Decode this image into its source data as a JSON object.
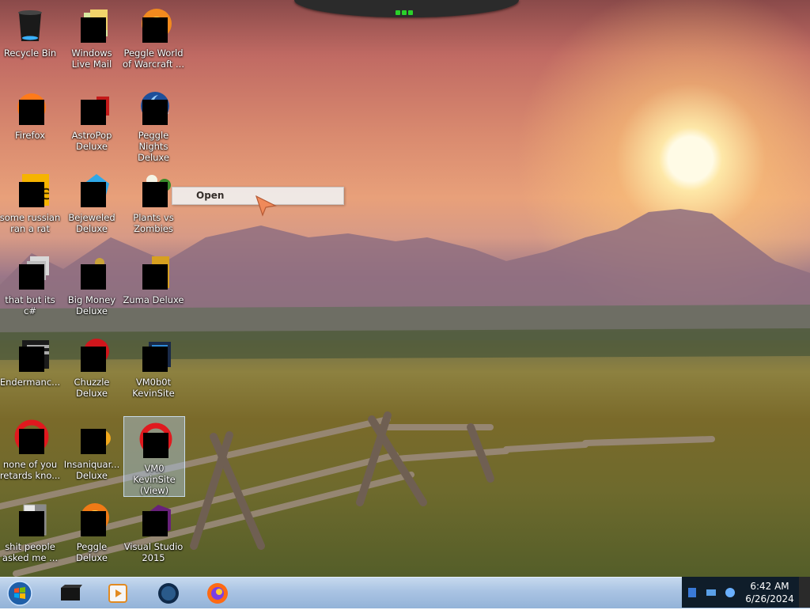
{
  "desktop_icons": [
    {
      "label": "Recycle Bin",
      "icon": "recycle-bin-icon"
    },
    {
      "label": "Windows Live Mail",
      "icon": "mail-icon"
    },
    {
      "label": "Peggle World of Warcraft ...",
      "icon": "peggle-icon"
    },
    {
      "label": "Firefox",
      "icon": "firefox-icon"
    },
    {
      "label": "AstroPop Deluxe",
      "icon": "astropop-icon"
    },
    {
      "label": "Peggle Nights Deluxe",
      "icon": "peggle-nights-icon"
    },
    {
      "label": "some russian ran a rat",
      "icon": "file-icon"
    },
    {
      "label": "Bejeweled Deluxe",
      "icon": "bejeweled-icon"
    },
    {
      "label": "Plants vs Zombies",
      "icon": "pvz-icon"
    },
    {
      "label": "that but its c#",
      "icon": "files-icon"
    },
    {
      "label": "Big Money Deluxe",
      "icon": "big-money-icon"
    },
    {
      "label": "Zuma Deluxe",
      "icon": "zuma-icon"
    },
    {
      "label": "Endermanc...",
      "icon": "app-icon"
    },
    {
      "label": "Chuzzle Deluxe",
      "icon": "chuzzle-icon"
    },
    {
      "label": "VM0b0t KevinSite",
      "icon": "vm-icon"
    },
    {
      "label": "none of you retards kno...",
      "icon": "opera-icon"
    },
    {
      "label": "Insaniquar... Deluxe",
      "icon": "insaniquarium-icon"
    },
    {
      "label": "VM0 KevinSite (View)",
      "icon": "opera-icon"
    },
    {
      "label": "shit people asked me ...",
      "icon": "document-icon"
    },
    {
      "label": "Peggle Deluxe",
      "icon": "peggle-icon"
    },
    {
      "label": "Visual Studio 2015",
      "icon": "visual-studio-icon"
    }
  ],
  "context_menu": {
    "items": [
      {
        "label": "Open"
      }
    ]
  },
  "taskbar": {
    "pinned": [
      {
        "icon": "black-box-icon"
      },
      {
        "icon": "media-player-icon"
      },
      {
        "icon": "globe-icon"
      },
      {
        "icon": "firefox-icon"
      }
    ],
    "clock": {
      "time": "6:42 AM",
      "date": "6/26/2024"
    }
  },
  "colors": {
    "selection": "#aac8e6",
    "taskbar": "#a9c3e3",
    "tray": "#0f1d2a"
  }
}
